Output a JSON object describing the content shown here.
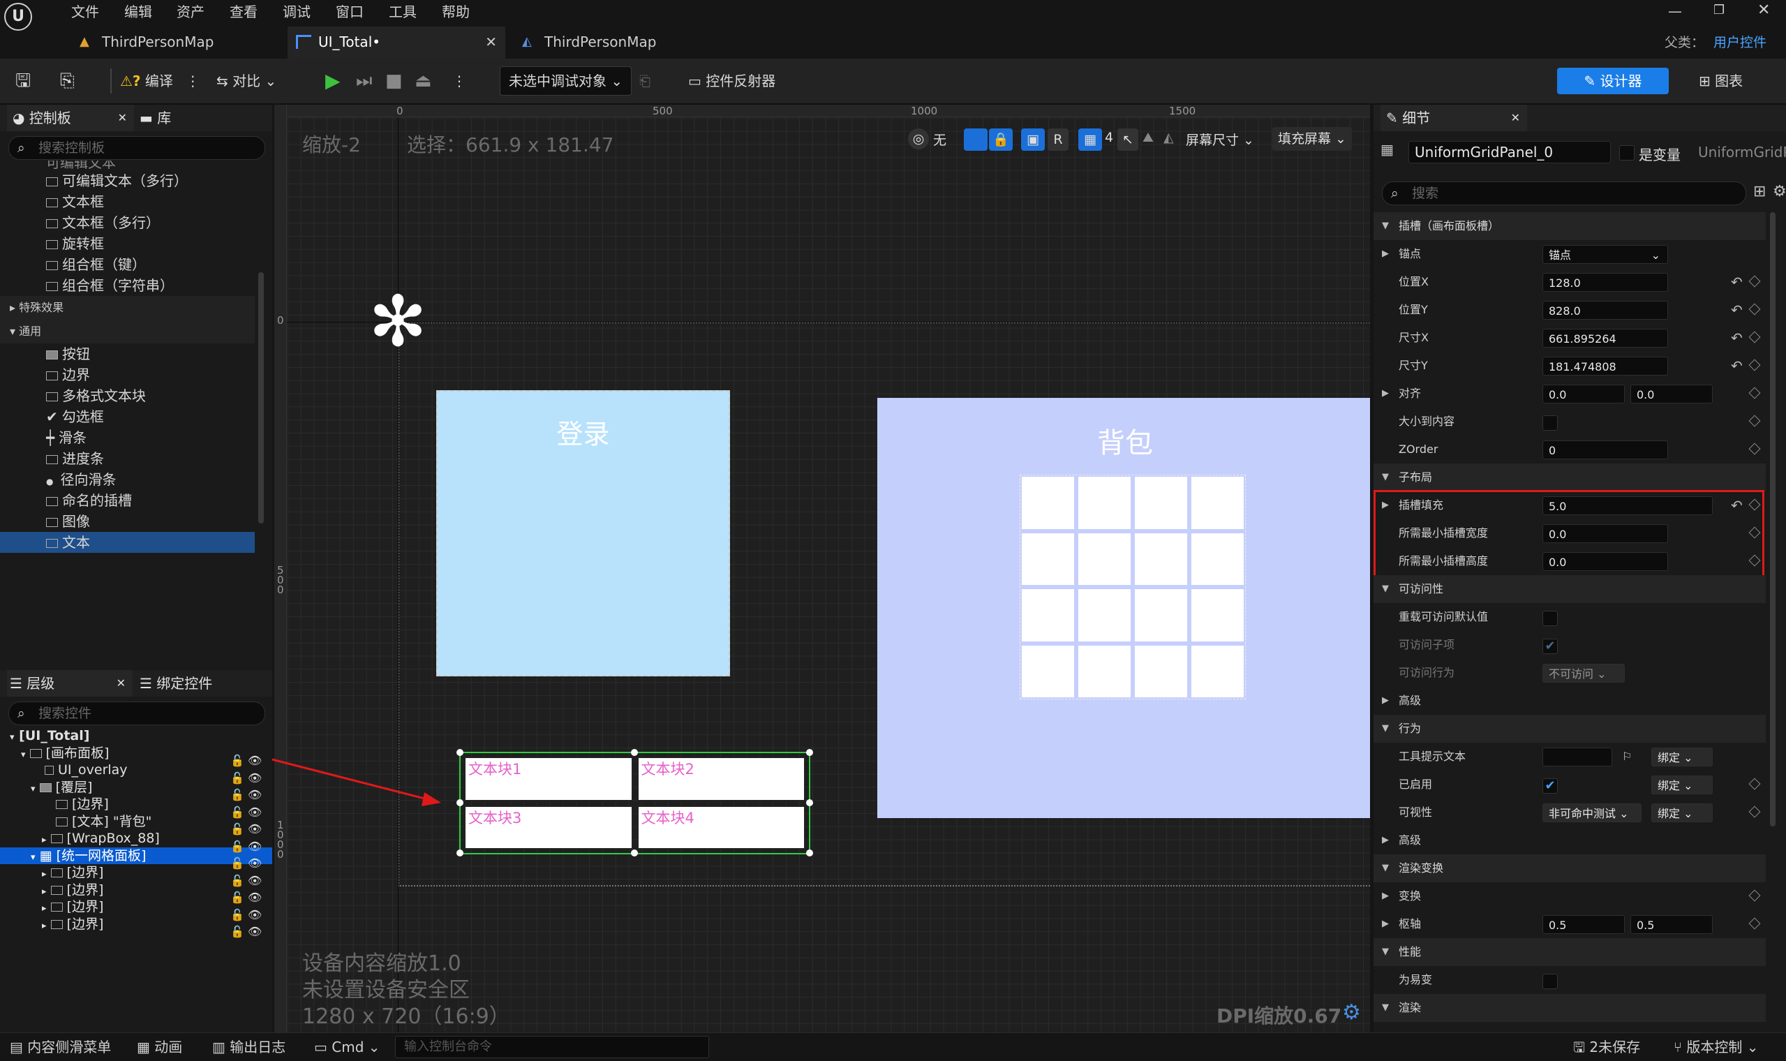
{
  "menu": [
    "文件",
    "编辑",
    "资产",
    "查看",
    "调试",
    "窗口",
    "工具",
    "帮助"
  ],
  "tabs": [
    "ThirdPersonMap",
    "UI_Total•",
    "ThirdPersonMap"
  ],
  "parent_class": {
    "label": "父类：",
    "value": "用户控件"
  },
  "toolbar": {
    "compile": "编译",
    "diff": "对比",
    "debug_target": "未选中调试对象",
    "reflector": "控件反射器",
    "designer": "设计器",
    "graph": "图表"
  },
  "palette": {
    "tab": "控制板",
    "library": "库",
    "search_placeholder": "搜索控制板",
    "items_top": [
      "可编辑文本",
      "可编辑文本（多行）",
      "文本框",
      "文本框（多行）",
      "旋转框",
      "组合框（键）",
      "组合框（字符串）"
    ],
    "cat_effects": "特殊效果",
    "cat_common": "通用",
    "items_common": [
      "按钮",
      "边界",
      "多格式文本块",
      "勾选框",
      "滑条",
      "进度条",
      "径向滑条",
      "命名的插槽",
      "图像",
      "文本"
    ]
  },
  "hierarchy": {
    "tab": "层级",
    "bind": "绑定控件",
    "search_placeholder": "搜索控件",
    "items": [
      "[UI_Total]",
      "[画布面板]",
      "UI_overlay",
      "[覆层]",
      "[边界]",
      "[文本] \"背包\"",
      "[WrapBox_88]",
      "[统一网格面板]",
      "[边界]",
      "[边界]",
      "[边界]",
      "[边界]"
    ]
  },
  "canvas": {
    "zoom": "缩放-2",
    "selection": "选择：661.9 x 181.47",
    "ruler": [
      "0",
      "500",
      "1000",
      "1500"
    ],
    "vruler": [
      "0",
      "500",
      "1000"
    ],
    "none": "无",
    "r": "R",
    "grid": "4",
    "screen_size": "屏幕尺寸",
    "fill_screen": "填充屏幕",
    "login": "登录",
    "bag": "背包",
    "cells": [
      "文本块1",
      "文本块2",
      "文本块3",
      "文本块4"
    ],
    "device_scale": "设备内容缩放1.0",
    "safe_zone": "未设置设备安全区",
    "resolution": "1280 x 720（16:9）",
    "dpi": "DPI缩放0.67"
  },
  "details": {
    "tab": "细节",
    "name": "UniformGridPanel_0",
    "is_var": "是变量",
    "class": "UniformGridP",
    "search_placeholder": "搜索",
    "slot_cat": "插槽（画布面板槽）",
    "anchor": "锚点",
    "anchor_val": "锚点",
    "posx": "位置X",
    "posx_val": "128.0",
    "posy": "位置Y",
    "posy_val": "828.0",
    "sizex": "尺寸X",
    "sizex_val": "661.895264",
    "sizey": "尺寸Y",
    "sizey_val": "181.474808",
    "align": "对齐",
    "align_x": "0.0",
    "align_y": "0.0",
    "autosize": "大小到内容",
    "zorder": "ZOrder",
    "zorder_val": "0",
    "child_layout": "子布局",
    "slot_padding": "插槽填充",
    "slot_padding_val": "5.0",
    "min_w": "所需最小插槽宽度",
    "min_w_val": "0.0",
    "min_h": "所需最小插槽高度",
    "min_h_val": "0.0",
    "access": "可访问性",
    "override_access": "重载可访问默认值",
    "access_children": "可访问子项",
    "access_behavior": "可访问行为",
    "access_behavior_val": "不可访问",
    "advanced": "高级",
    "behavior": "行为",
    "tooltip": "工具提示文本",
    "bind": "绑定",
    "enabled": "已启用",
    "visibility": "可视性",
    "visibility_val": "非可命中测试",
    "advanced2": "高级",
    "render_transform": "渲染变换",
    "transform": "变换",
    "pivot": "枢轴",
    "pivot_x": "0.5",
    "pivot_y": "0.5",
    "perf": "性能",
    "volatile": "为易变",
    "render": "渲染"
  },
  "status": {
    "drawer": "内容侧滑菜单",
    "anim": "动画",
    "log": "输出日志",
    "cmd": "Cmd",
    "cmd_placeholder": "输入控制台命令",
    "unsaved": "2未保存",
    "vc": "版本控制"
  },
  "colors": {
    "login_bg": "#b8e2fc",
    "bag_bg": "#c5cffc",
    "accent": "#0a5bd0",
    "highlight": "#e0191a",
    "cell_text": "#e661c8"
  }
}
